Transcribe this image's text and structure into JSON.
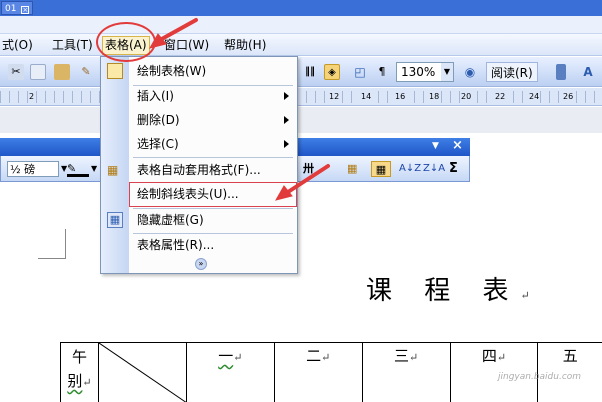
{
  "window": {
    "tab_label": "01",
    "close_glyph": "×"
  },
  "menubar": {
    "items": [
      {
        "label": "式(O)"
      },
      {
        "label": "工具(T)"
      },
      {
        "label": "表格(A)"
      },
      {
        "label": "窗口(W)"
      },
      {
        "label": "帮助(H)"
      }
    ]
  },
  "toolbar": {
    "zoom_value": "130%",
    "read_label": "阅读(R)",
    "icons": [
      "cut-icon",
      "copy-icon",
      "paste-icon",
      "format-painter-icon",
      "columns-icon",
      "drawing-icon",
      "doc-map-icon",
      "help-icon",
      "font-size-icon"
    ]
  },
  "ruler": {
    "marks": [
      "2",
      "12",
      "14",
      "16",
      "18",
      "20",
      "22",
      "24",
      "26"
    ]
  },
  "tables_toolbar": {
    "line_weight": "½ 磅",
    "close_glyph": "×",
    "sort_asc": "A↓Z",
    "sort_desc": "Z↓A",
    "sum": "Σ"
  },
  "table_menu": {
    "items": [
      {
        "label": "绘制表格(W)",
        "icon": "draw-table-icon",
        "submenu": false
      },
      {
        "label": "插入(I)",
        "icon": "",
        "submenu": true
      },
      {
        "label": "删除(D)",
        "icon": "",
        "submenu": true
      },
      {
        "label": "选择(C)",
        "icon": "",
        "submenu": true
      },
      {
        "label": "表格自动套用格式(F)...",
        "icon": "autoformat-icon",
        "submenu": false
      },
      {
        "label": "绘制斜线表头(U)...",
        "icon": "",
        "submenu": false
      },
      {
        "label": "隐藏虚框(G)",
        "icon": "gridlines-icon",
        "submenu": false
      },
      {
        "label": "表格属性(R)...",
        "icon": "",
        "submenu": false
      }
    ],
    "expand_glyph": "»"
  },
  "document": {
    "heading": "课 程 表",
    "paragraph_mark": "↵",
    "table": {
      "first_cell": [
        "午",
        "别"
      ],
      "headers": [
        "一",
        "二",
        "三",
        "四",
        "五"
      ]
    }
  },
  "watermark": "jingyan.baidu.com",
  "colors": {
    "accent": "#e23b3b",
    "menu_highlight": "#d9424e",
    "titlebar": "#3a6fd8"
  }
}
